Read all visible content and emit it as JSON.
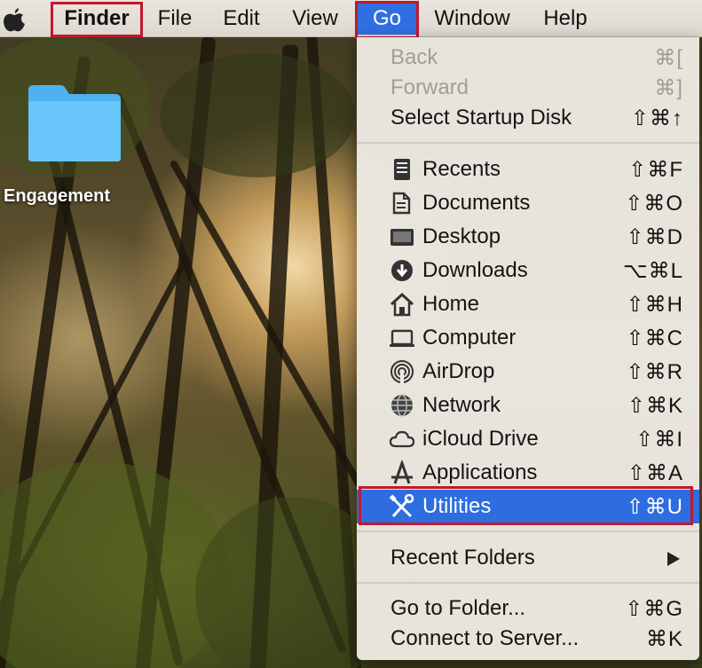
{
  "menubar": {
    "apple_icon": "apple-logo-icon",
    "items": [
      {
        "label": "Finder"
      },
      {
        "label": "File"
      },
      {
        "label": "Edit"
      },
      {
        "label": "View"
      },
      {
        "label": "Go"
      },
      {
        "label": "Window"
      },
      {
        "label": "Help"
      }
    ]
  },
  "desktop": {
    "folder": {
      "label": "Engagement",
      "icon": "folder-icon",
      "color": "#5fbff5"
    }
  },
  "go_menu": {
    "history": [
      {
        "label": "Back",
        "shortcut": "⌘[",
        "enabled": false
      },
      {
        "label": "Forward",
        "shortcut": "⌘]",
        "enabled": false
      },
      {
        "label": "Select Startup Disk",
        "shortcut": "⇧⌘↑",
        "enabled": true
      }
    ],
    "places": [
      {
        "label": "Recents",
        "shortcut": "⇧⌘F",
        "icon": "recents-icon"
      },
      {
        "label": "Documents",
        "shortcut": "⇧⌘O",
        "icon": "documents-icon"
      },
      {
        "label": "Desktop",
        "shortcut": "⇧⌘D",
        "icon": "desktop-icon"
      },
      {
        "label": "Downloads",
        "shortcut": "⌥⌘L",
        "icon": "downloads-icon"
      },
      {
        "label": "Home",
        "shortcut": "⇧⌘H",
        "icon": "home-icon"
      },
      {
        "label": "Computer",
        "shortcut": "⇧⌘C",
        "icon": "computer-icon"
      },
      {
        "label": "AirDrop",
        "shortcut": "⇧⌘R",
        "icon": "airdrop-icon"
      },
      {
        "label": "Network",
        "shortcut": "⇧⌘K",
        "icon": "network-icon"
      },
      {
        "label": "iCloud Drive",
        "shortcut": "⇧⌘I",
        "icon": "icloud-icon"
      },
      {
        "label": "Applications",
        "shortcut": "⇧⌘A",
        "icon": "applications-icon"
      },
      {
        "label": "Utilities",
        "shortcut": "⇧⌘U",
        "icon": "utilities-icon",
        "highlighted": true
      }
    ],
    "recent_folders": {
      "label": "Recent Folders",
      "icon": "submenu-arrow-icon"
    },
    "folder_actions": [
      {
        "label": "Go to Folder...",
        "shortcut": "⇧⌘G"
      },
      {
        "label": "Connect to Server...",
        "shortcut": "⌘K"
      }
    ]
  },
  "colors": {
    "selection": "#2d6de0",
    "annotation_box": "#c1192c",
    "disabled_text": "#a29d95"
  }
}
